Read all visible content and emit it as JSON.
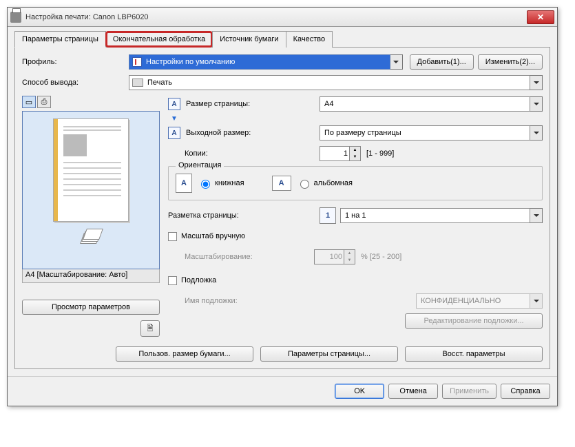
{
  "title": "Настройка печати: Canon LBP6020",
  "tabs": {
    "page": "Параметры страницы",
    "finishing": "Окончательная обработка",
    "paper": "Источник бумаги",
    "quality": "Качество"
  },
  "labels": {
    "profile": "Профиль:",
    "output_method": "Способ вывода:",
    "page_size": "Размер страницы:",
    "output_size": "Выходной размер:",
    "copies": "Копии:",
    "copies_range": "[1 - 999]",
    "orientation": "Ориентация",
    "portrait": "книжная",
    "landscape": "альбомная",
    "page_layout": "Разметка страницы:",
    "manual_scale": "Масштаб вручную",
    "scaling": "Масштабирование:",
    "scale_range": "% [25 - 200]",
    "watermark": "Подложка",
    "watermark_name": "Имя подложки:"
  },
  "values": {
    "profile": "Настройки по умолчанию",
    "output_method": "Печать",
    "page_size": "A4",
    "output_size": "По размеру страницы",
    "copies": "1",
    "layout": "1 на 1",
    "scale": "100",
    "watermark_name": "КОНФИДЕНЦИАЛЬНО",
    "preview_status": "A4 [Масштабирование: Авто]"
  },
  "buttons": {
    "add": "Добавить(1)...",
    "edit": "Изменить(2)...",
    "view_params": "Просмотр параметров",
    "edit_watermark": "Редактирование подложки...",
    "custom_size": "Пользов. размер бумаги...",
    "page_params": "Параметры страницы...",
    "restore": "Восст. параметры",
    "ok": "OK",
    "cancel": "Отмена",
    "apply": "Применить",
    "help": "Справка"
  },
  "icons": {
    "page_A": "A",
    "layout_1": "1"
  }
}
